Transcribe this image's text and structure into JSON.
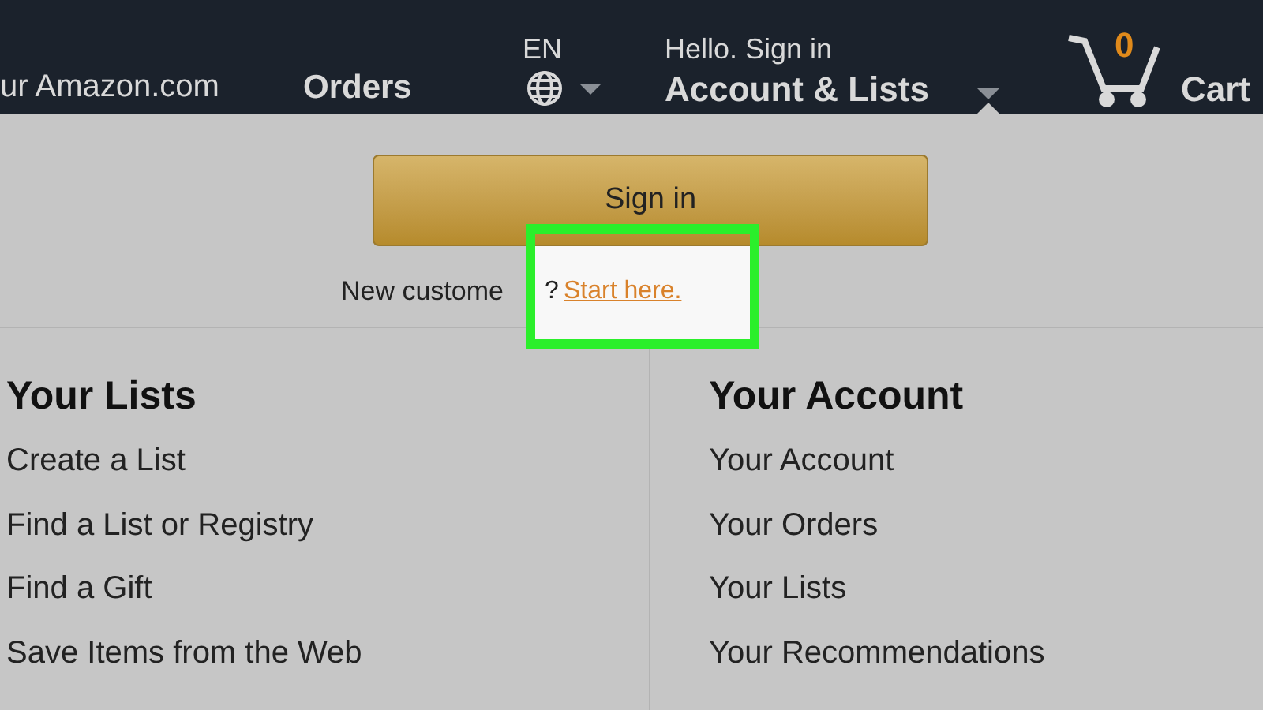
{
  "nav": {
    "site_link": "ur Amazon.com",
    "orders": "Orders",
    "language": "EN",
    "greeting": "Hello. Sign in",
    "account": "Account & Lists",
    "cart_count": "0",
    "cart": "Cart"
  },
  "signin": {
    "button": "Sign in",
    "prompt_start": "New custome",
    "prompt_end": "?",
    "link": "Start here."
  },
  "columns": [
    {
      "title": "Your Lists",
      "items": [
        "Create a List",
        "Find a List or Registry",
        "Find a Gift",
        "Save Items from the Web"
      ]
    },
    {
      "title": "Your Account",
      "items": [
        "Your Account",
        "Your Orders",
        "Your Lists",
        "Your Recommendations"
      ]
    }
  ]
}
